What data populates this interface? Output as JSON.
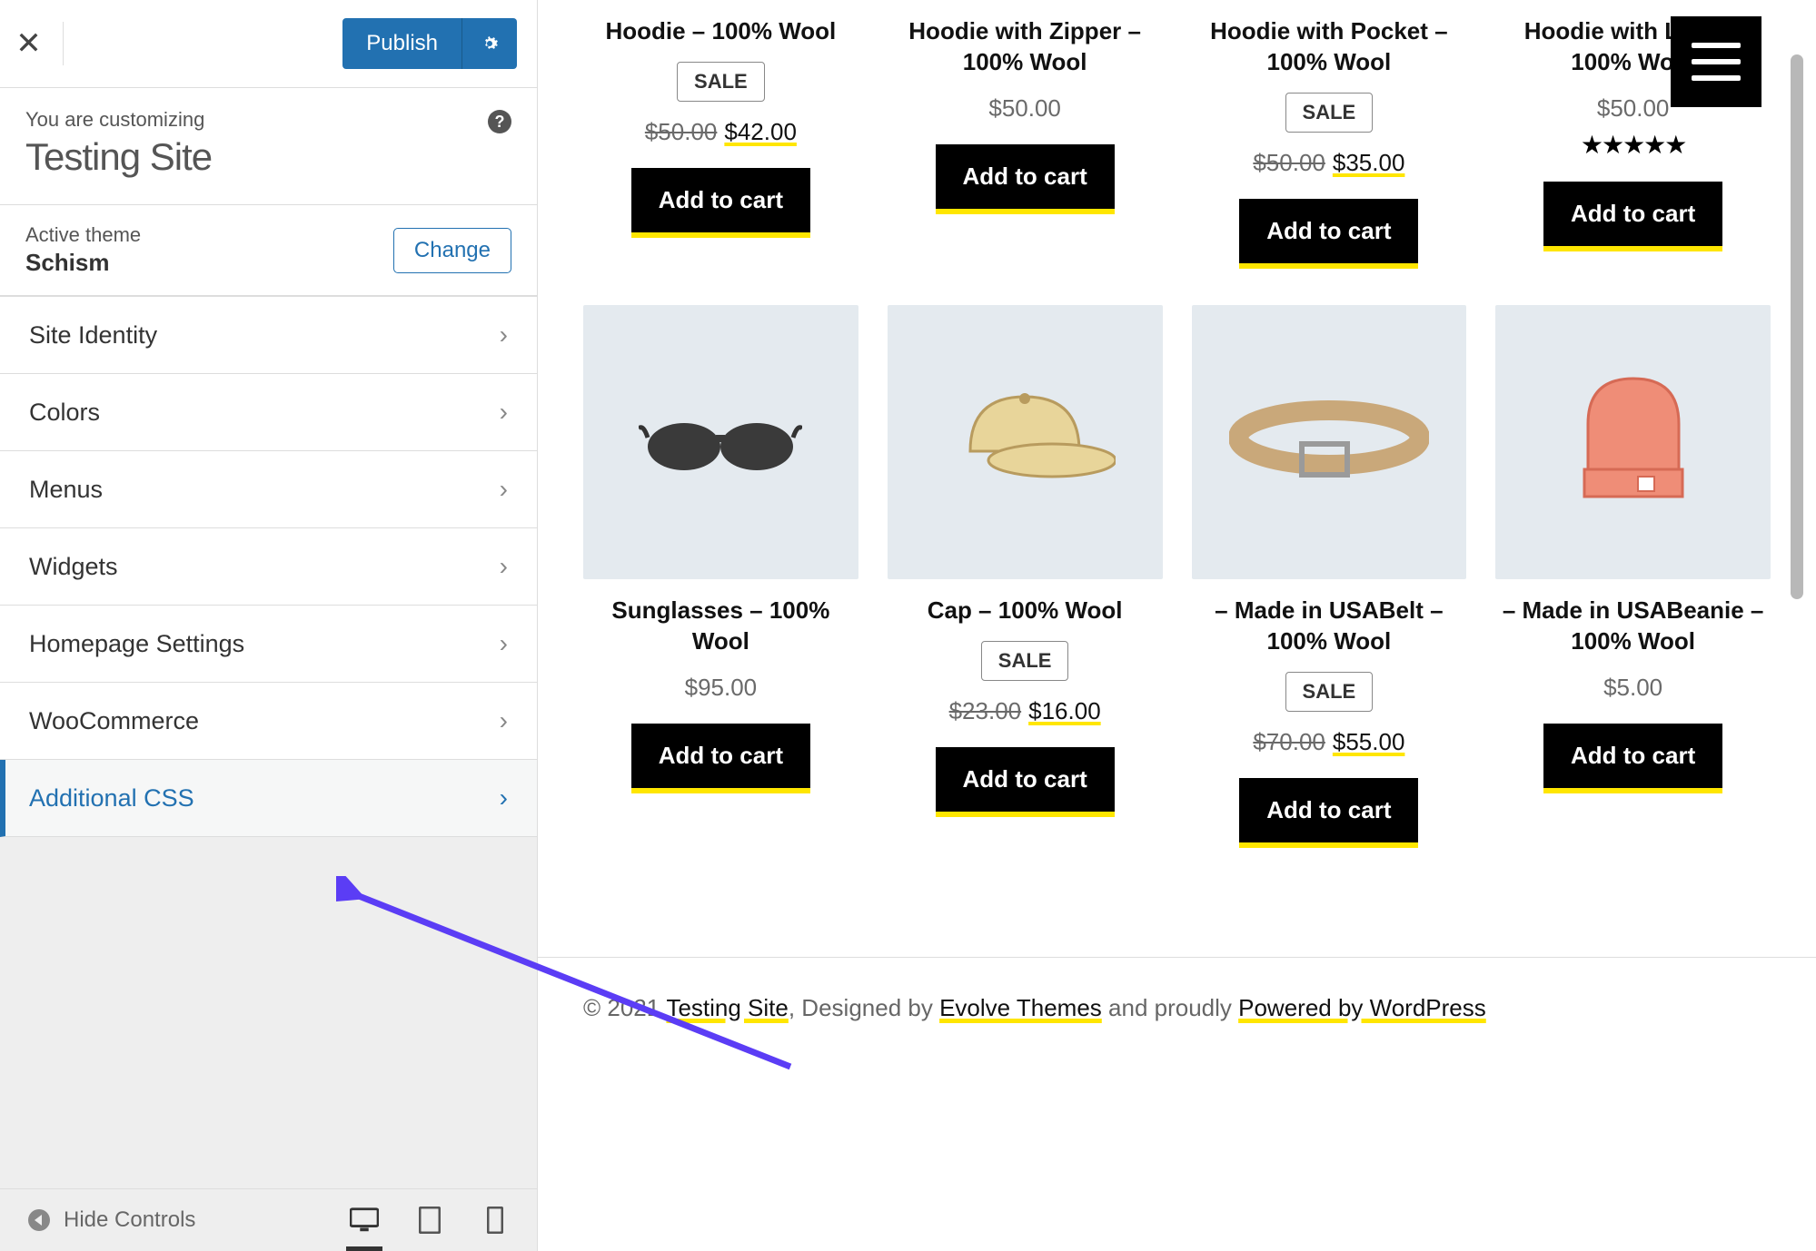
{
  "sidebar": {
    "publish_label": "Publish",
    "customizing_small": "You are customizing",
    "site_title": "Testing Site",
    "active_theme_label": "Active theme",
    "theme_name": "Schism",
    "change_label": "Change",
    "items": [
      {
        "label": "Site Identity"
      },
      {
        "label": "Colors"
      },
      {
        "label": "Menus"
      },
      {
        "label": "Widgets"
      },
      {
        "label": "Homepage Settings"
      },
      {
        "label": "WooCommerce"
      },
      {
        "label": "Additional CSS"
      }
    ],
    "hide_controls": "Hide Controls"
  },
  "products_row1": [
    {
      "title": "Hoodie – 100% Wool",
      "sale": "SALE",
      "old": "$50.00",
      "new": "$42.00",
      "cta": "Add to cart",
      "stars": false
    },
    {
      "title": "Hoodie with Zipper – 100% Wool",
      "sale": null,
      "old": null,
      "new": "$50.00",
      "cta": "Add to cart",
      "stars": false
    },
    {
      "title": "Hoodie with Pocket – 100% Wool",
      "sale": "SALE",
      "old": "$50.00",
      "new": "$35.00",
      "cta": "Add to cart",
      "stars": false
    },
    {
      "title": "Hoodie with Logo – 100% Wool",
      "sale": null,
      "old": null,
      "new": "$50.00",
      "cta": "Add to cart",
      "stars": true
    }
  ],
  "products_row2": [
    {
      "title": "Sunglasses – 100% Wool",
      "sale": null,
      "old": null,
      "new": "$95.00",
      "cta": "Add to cart"
    },
    {
      "title": "Cap – 100% Wool",
      "sale": "SALE",
      "old": "$23.00",
      "new": "$16.00",
      "cta": "Add to cart"
    },
    {
      "title": "– Made in USABelt – 100% Wool",
      "sale": "SALE",
      "old": "$70.00",
      "new": "$55.00",
      "cta": "Add to cart"
    },
    {
      "title": "– Made in USABeanie – 100% Wool",
      "sale": null,
      "old": null,
      "new": "$5.00",
      "cta": "Add to cart"
    }
  ],
  "footer": {
    "copyright": "© 2021 ",
    "site_link": "Testing Site",
    "designed_by": ", Designed by ",
    "themes_link": "Evolve Themes",
    "proudly": " and proudly ",
    "wp_link": "Powered by WordPress"
  }
}
